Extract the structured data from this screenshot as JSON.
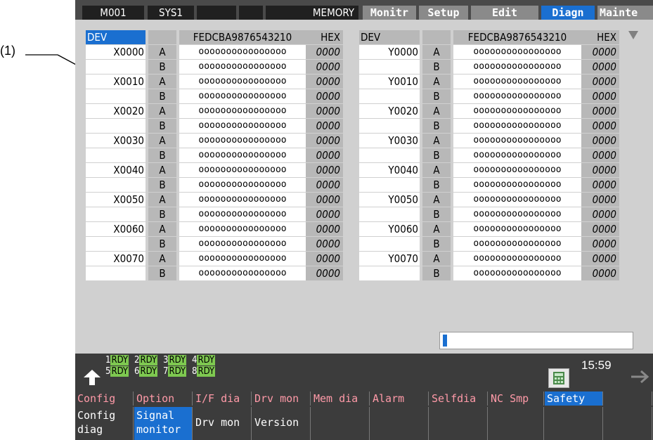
{
  "callout_label": "(1)",
  "header": {
    "mode": "M001",
    "system": "SYS1",
    "memory": "MEMORY"
  },
  "main_tabs": [
    {
      "label": "Monitr"
    },
    {
      "label": "Setup"
    },
    {
      "label": "Edit"
    },
    {
      "label": "Diagn"
    },
    {
      "label": "Mainte"
    }
  ],
  "active_tab": "Diagn",
  "table": {
    "dev_header": "DEV",
    "bits_header": "FEDCBA9876543210",
    "hex_header": "HEX",
    "left_rows": [
      {
        "dev": "X0000",
        "ab": "A",
        "bits": "oooooooooooooooo",
        "hex": "0000"
      },
      {
        "dev": "",
        "ab": "B",
        "bits": "oooooooooooooooo",
        "hex": "0000"
      },
      {
        "dev": "X0010",
        "ab": "A",
        "bits": "oooooooooooooooo",
        "hex": "0000"
      },
      {
        "dev": "",
        "ab": "B",
        "bits": "oooooooooooooooo",
        "hex": "0000"
      },
      {
        "dev": "X0020",
        "ab": "A",
        "bits": "oooooooooooooooo",
        "hex": "0000"
      },
      {
        "dev": "",
        "ab": "B",
        "bits": "oooooooooooooooo",
        "hex": "0000"
      },
      {
        "dev": "X0030",
        "ab": "A",
        "bits": "oooooooooooooooo",
        "hex": "0000"
      },
      {
        "dev": "",
        "ab": "B",
        "bits": "oooooooooooooooo",
        "hex": "0000"
      },
      {
        "dev": "X0040",
        "ab": "A",
        "bits": "oooooooooooooooo",
        "hex": "0000"
      },
      {
        "dev": "",
        "ab": "B",
        "bits": "oooooooooooooooo",
        "hex": "0000"
      },
      {
        "dev": "X0050",
        "ab": "A",
        "bits": "oooooooooooooooo",
        "hex": "0000"
      },
      {
        "dev": "",
        "ab": "B",
        "bits": "oooooooooooooooo",
        "hex": "0000"
      },
      {
        "dev": "X0060",
        "ab": "A",
        "bits": "oooooooooooooooo",
        "hex": "0000"
      },
      {
        "dev": "",
        "ab": "B",
        "bits": "oooooooooooooooo",
        "hex": "0000"
      },
      {
        "dev": "X0070",
        "ab": "A",
        "bits": "oooooooooooooooo",
        "hex": "0000"
      },
      {
        "dev": "",
        "ab": "B",
        "bits": "oooooooooooooooo",
        "hex": "0000"
      }
    ],
    "right_rows": [
      {
        "dev": "Y0000",
        "ab": "A",
        "bits": "oooooooooooooooo",
        "hex": "0000"
      },
      {
        "dev": "",
        "ab": "B",
        "bits": "oooooooooooooooo",
        "hex": "0000"
      },
      {
        "dev": "Y0010",
        "ab": "A",
        "bits": "oooooooooooooooo",
        "hex": "0000"
      },
      {
        "dev": "",
        "ab": "B",
        "bits": "oooooooooooooooo",
        "hex": "0000"
      },
      {
        "dev": "Y0020",
        "ab": "A",
        "bits": "oooooooooooooooo",
        "hex": "0000"
      },
      {
        "dev": "",
        "ab": "B",
        "bits": "oooooooooooooooo",
        "hex": "0000"
      },
      {
        "dev": "Y0030",
        "ab": "A",
        "bits": "oooooooooooooooo",
        "hex": "0000"
      },
      {
        "dev": "",
        "ab": "B",
        "bits": "oooooooooooooooo",
        "hex": "0000"
      },
      {
        "dev": "Y0040",
        "ab": "A",
        "bits": "oooooooooooooooo",
        "hex": "0000"
      },
      {
        "dev": "",
        "ab": "B",
        "bits": "oooooooooooooooo",
        "hex": "0000"
      },
      {
        "dev": "Y0050",
        "ab": "A",
        "bits": "oooooooooooooooo",
        "hex": "0000"
      },
      {
        "dev": "",
        "ab": "B",
        "bits": "oooooooooooooooo",
        "hex": "0000"
      },
      {
        "dev": "Y0060",
        "ab": "A",
        "bits": "oooooooooooooooo",
        "hex": "0000"
      },
      {
        "dev": "",
        "ab": "B",
        "bits": "oooooooooooooooo",
        "hex": "0000"
      },
      {
        "dev": "Y0070",
        "ab": "A",
        "bits": "oooooooooooooooo",
        "hex": "0000"
      },
      {
        "dev": "",
        "ab": "B",
        "bits": "oooooooooooooooo",
        "hex": "0000"
      }
    ]
  },
  "input_value": "",
  "status": {
    "systems": [
      {
        "num": "1",
        "state": "RDY"
      },
      {
        "num": "2",
        "state": "RDY"
      },
      {
        "num": "3",
        "state": "RDY"
      },
      {
        "num": "4",
        "state": "RDY"
      },
      {
        "num": "5",
        "state": "RDY"
      },
      {
        "num": "6",
        "state": "RDY"
      },
      {
        "num": "7",
        "state": "RDY"
      },
      {
        "num": "8",
        "state": "RDY"
      }
    ],
    "clock": "15:59"
  },
  "menu_main": [
    {
      "label": "Config"
    },
    {
      "label": "Option"
    },
    {
      "label": "I/F dia"
    },
    {
      "label": "Drv mon"
    },
    {
      "label": "Mem dia"
    },
    {
      "label": "Alarm"
    },
    {
      "label": "Selfdia"
    },
    {
      "label": "NC Smp"
    },
    {
      "label": "Safety"
    },
    {
      "label": ""
    }
  ],
  "menu_main_selected": "Safety",
  "menu_sub": [
    {
      "line1": "Config",
      "line2": "diag"
    },
    {
      "line1": "Signal",
      "line2": "monitor"
    },
    {
      "line1": "Drv mon",
      "line2": ""
    },
    {
      "line1": "Version",
      "line2": ""
    },
    {
      "line1": "",
      "line2": ""
    },
    {
      "line1": "",
      "line2": ""
    },
    {
      "line1": "",
      "line2": ""
    },
    {
      "line1": "",
      "line2": ""
    },
    {
      "line1": "",
      "line2": ""
    },
    {
      "line1": "",
      "line2": ""
    }
  ],
  "menu_sub_selected": "Signal",
  "colors": {
    "accent": "#1a6fd0",
    "rdy_green": "#7ec850",
    "menu_text": "#ff9aa8",
    "panel_gray": "#d0d0d0"
  },
  "icons": {
    "back": "return-arrow-icon",
    "calculator": "calculator-icon",
    "next": "next-arrow-icon",
    "scroll": "scroll-down-icon"
  }
}
